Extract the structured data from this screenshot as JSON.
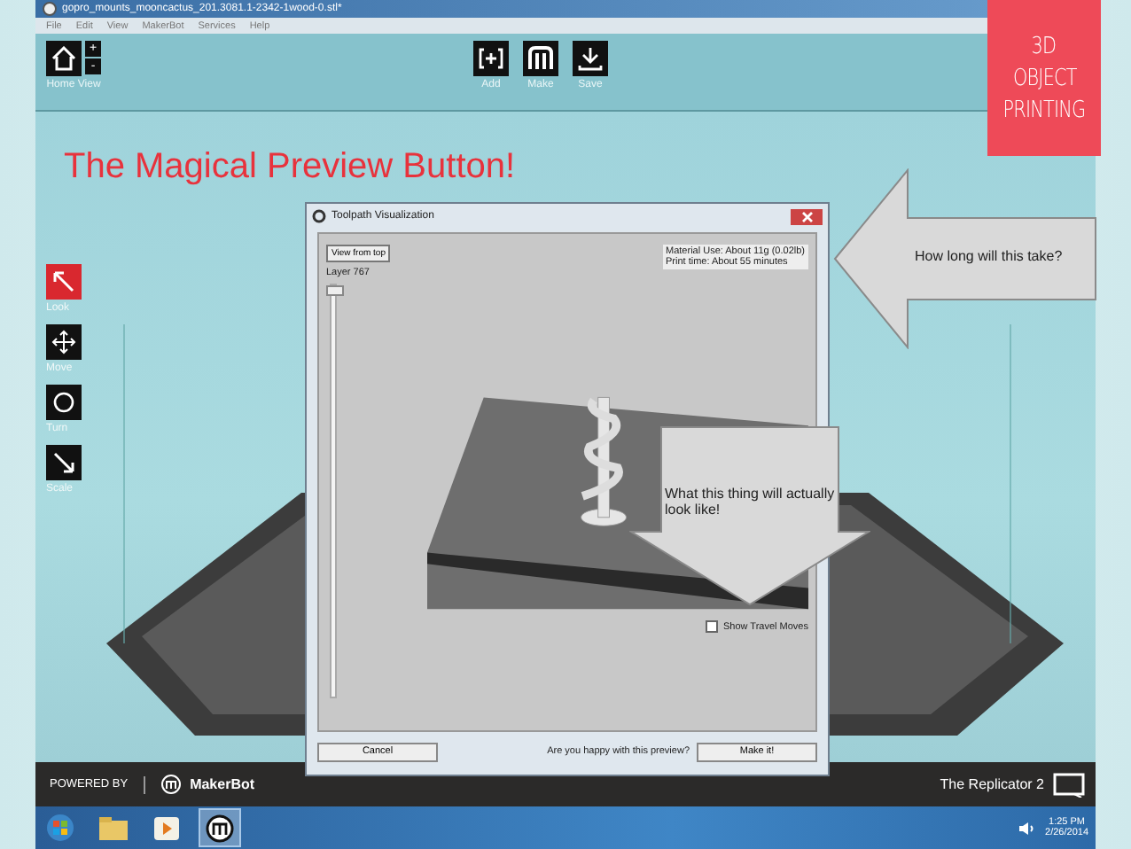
{
  "window": {
    "title": "gopro_mounts_mooncactus_201.3081.1-2342-1wood-0.stl*",
    "menu": [
      "File",
      "Edit",
      "View",
      "MakerBot",
      "Services",
      "Help"
    ]
  },
  "toolbar": {
    "home": "Home View",
    "zoom": [
      "+",
      "-"
    ],
    "actions": [
      {
        "label": "Add",
        "kind": "add"
      },
      {
        "label": "Make",
        "kind": "make"
      },
      {
        "label": "Save",
        "kind": "save"
      }
    ]
  },
  "tools": [
    {
      "label": "Look",
      "selected": true
    },
    {
      "label": "Move",
      "selected": false
    },
    {
      "label": "Turn",
      "selected": false
    },
    {
      "label": "Scale",
      "selected": false
    }
  ],
  "slide_heading": "The Magical Preview Button!",
  "ribbon": [
    "3D",
    "OBJECT",
    "PRINTING"
  ],
  "callouts": [
    {
      "kind": "left",
      "text": "How long will this take?"
    },
    {
      "kind": "down",
      "text": "What this thing will actually look like!"
    }
  ],
  "dialog": {
    "title": "Toolpath Visualization",
    "view_button": "View from top",
    "layer": "Layer 767",
    "layer_slider": {
      "level": 1
    },
    "info": [
      "Material Use: About 11g (0.02lb)",
      "Print time: About 55 minutes"
    ],
    "travel": {
      "label": "Show Travel Moves",
      "checked": false
    },
    "cancel": "Cancel",
    "question": "Are you happy with this preview?",
    "make": "Make it!"
  },
  "footer": {
    "powered": "POWERED BY",
    "brand": "MakerBot",
    "printer": "The Replicator 2"
  },
  "taskbar": {
    "time": "1:25 PM",
    "date": "2/26/2014"
  }
}
